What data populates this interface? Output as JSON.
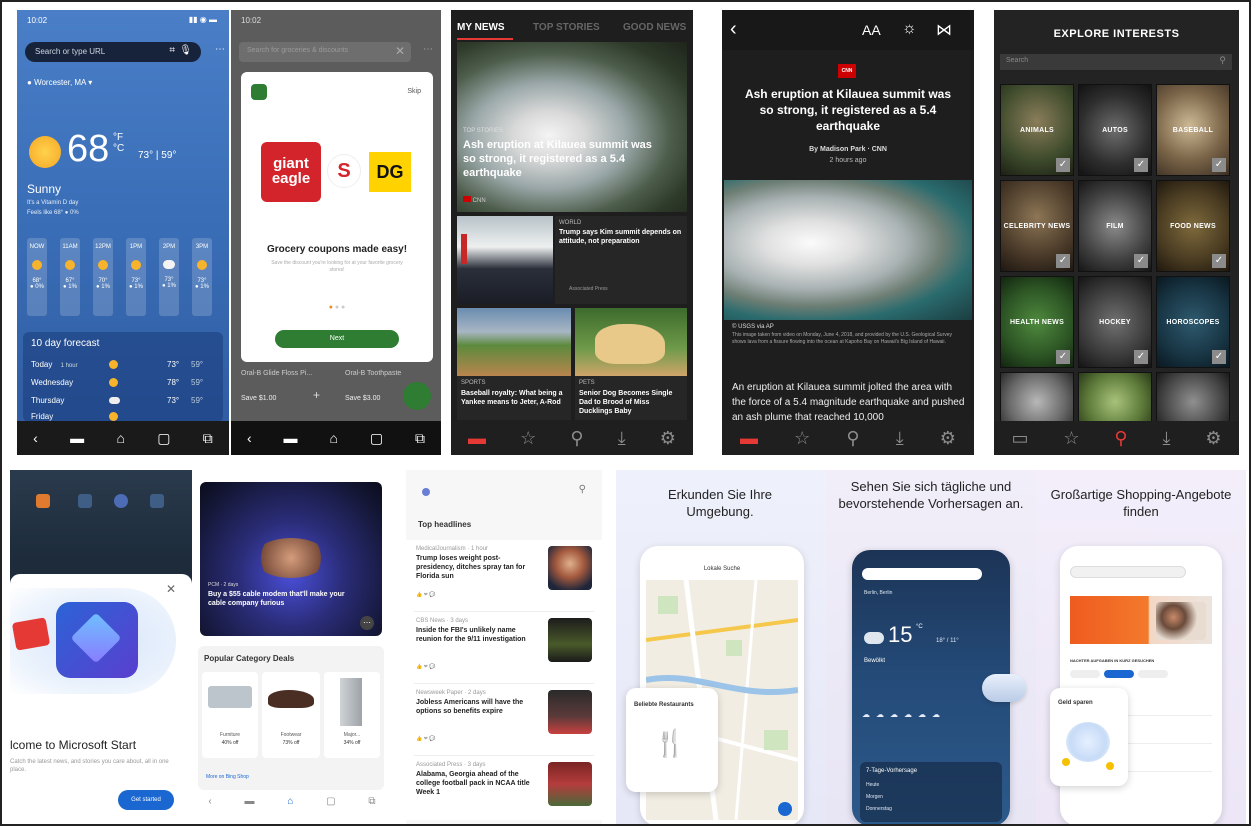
{
  "p1": {
    "status_time": "10:02",
    "search_placeholder": "Search or type URL",
    "location": "Worcester, MA",
    "temp": "68",
    "units": "°F\n°C",
    "hi_lo": "73° | 59°",
    "condition": "Sunny",
    "detail1": "It's a Vitamin D day",
    "detail2": "Feels like 68°  ● 0%",
    "hours": [
      "NOW",
      "11AM",
      "12PM",
      "1PM",
      "2PM",
      "3PM"
    ],
    "hour_temps": [
      "68°",
      "67°",
      "70°",
      "73°",
      "73°",
      "73°"
    ],
    "hour_pct": [
      "● 0%",
      "● 1%",
      "● 1%",
      "● 1%",
      "● 1%",
      "● 1%"
    ],
    "forecast_title": "10 day forecast",
    "forecast_days": [
      "Today",
      "Wednesday",
      "Thursday",
      "Friday"
    ],
    "forecast_note": "1 hour",
    "forecast_hi": [
      "73°",
      "78°",
      "73°",
      "73°"
    ],
    "forecast_lo": [
      "59°",
      "59°",
      "59°",
      "59°"
    ]
  },
  "p2": {
    "status_time": "10:02",
    "search_text": "Search for groceries & discounts",
    "skip": "Skip",
    "brand1": "giant eagle",
    "brand2": "S",
    "brand3": "DG",
    "headline": "Grocery coupons made easy!",
    "sub": "Save the discount you're looking for at your favorite grocery stores!",
    "next": "Next",
    "deal1": "Oral-B Glide Floss Pi...",
    "deal2": "Oral-B Toothpaste",
    "save1": "Save $1.00",
    "save2": "Save $3.00"
  },
  "p3": {
    "tabs": [
      "MY NEWS",
      "TOP STORIES",
      "GOOD NEWS"
    ],
    "kicker": "TOP STORIES",
    "headline": "Ash eruption at Kilauea summit was so strong, it registered as a 5.4 earthquake",
    "source": "CNN",
    "w_kicker": "WORLD",
    "w_title": "Trump says Kim summit depends on attitude, not preparation",
    "w_source": "Associated Press",
    "s_kicker": "SPORTS",
    "s_title": "Baseball royalty: What being a Yankee means to Jeter, A-Rod",
    "p_kicker": "PETS",
    "p_title": "Senior Dog Becomes Single Dad to Brood of Miss Ducklings Baby"
  },
  "p4": {
    "aa": "AA",
    "logo": "CNN",
    "headline": "Ash eruption at Kilauea summit was so strong, it registered as a 5.4 earthquake",
    "byline": "By Madison Park · CNN",
    "time": "2 hours ago",
    "credit": "© USGS via AP",
    "caption": "This image taken from video on Monday, June 4, 2018, and provided by the U.S. Geological Survey shows lava from a fissure flowing into the ocean at Kapoho Bay on Hawaii's Big Island of Hawaii.",
    "body": "An eruption at Kilauea summit jolted the area with the force of a 5.4 magnitude earthquake and pushed an ash plume that reached 10,000"
  },
  "p5": {
    "title": "EXPLORE INTERESTS",
    "search": "Search",
    "tiles": [
      "ANIMALS",
      "AUTOS",
      "BASEBALL",
      "CELEBRITY NEWS",
      "FILM",
      "FOOD NEWS",
      "HEALTH NEWS",
      "HOCKEY",
      "HOROSCOPES",
      "",
      "",
      ""
    ]
  },
  "p6": {
    "welcome": "lcome to Microsoft Start",
    "sub": "Catch the latest news, and stories you care about, all in one place.",
    "cta": "Get started"
  },
  "p7": {
    "hero_source": "PCM · 2 days",
    "hero_title": "Buy a $55 cable modem that'll make your cable company furious",
    "section": "Popular Category Deals",
    "deals": [
      {
        "name": "Furniture",
        "off": "40% off"
      },
      {
        "name": "Footwear",
        "off": "73% off"
      },
      {
        "name": "Major...",
        "off": "34% off"
      }
    ],
    "more": "More on Bing Shop"
  },
  "p8": {
    "section": "Top headlines",
    "items": [
      {
        "src": "MedicalJournalism · 1 hour",
        "title": "Trump loses weight post-presidency, ditches spray tan for Florida sun"
      },
      {
        "src": "CBS News · 3 days",
        "title": "Inside the FBI's unlikely name reunion for the 9/11 investigation"
      },
      {
        "src": "Newsweek Paper · 2 days",
        "title": "Jobless Americans will have the options so benefits expire"
      },
      {
        "src": "Associated Press · 3 days",
        "title": "Alabama, Georgia ahead of the college football pack in NCAA title Week 1"
      }
    ]
  },
  "p9": {
    "heading": "Erkunden Sie Ihre Umgebung.",
    "map_title": "Lokale Suche",
    "card": "Beliebte Restaurants"
  },
  "p10": {
    "heading": "Sehen Sie sich tägliche und bevorstehende Vorhersagen an.",
    "location": "Berlin, Berlin",
    "temp": "15",
    "unit": "°C",
    "hilo": "18° / 11°",
    "cond": "Bewölkt",
    "forecast": "7-Tage-Vorhersage",
    "days": [
      "Heute",
      "Morgen",
      "Donnerstag"
    ]
  },
  "p11": {
    "heading": "Großartige Shopping-Angebote finden",
    "section": "NACHTER AUFGABEN IN KURZ GESUCHEN",
    "card": "Geld sparen"
  }
}
